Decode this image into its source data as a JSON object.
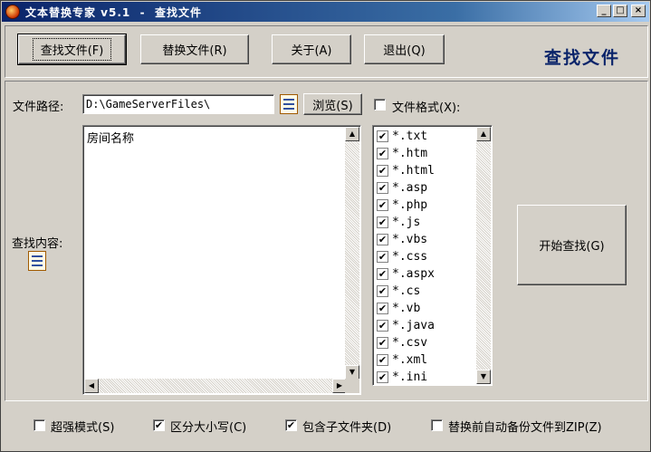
{
  "window": {
    "title": "文本替换专家 v5.1  -  查找文件"
  },
  "toolbar": {
    "find_files": "查找文件(F)",
    "replace_files": "替换文件(R)",
    "about": "关于(A)",
    "exit": "退出(Q)"
  },
  "page_heading": "查找文件",
  "path": {
    "label": "文件路径:",
    "value": "D:\\GameServerFiles\\",
    "browse": "浏览(S)"
  },
  "file_format": {
    "label": "文件格式(X):",
    "checked": false,
    "items": [
      {
        "ext": "*.txt",
        "checked": true
      },
      {
        "ext": "*.htm",
        "checked": true
      },
      {
        "ext": "*.html",
        "checked": true
      },
      {
        "ext": "*.asp",
        "checked": true
      },
      {
        "ext": "*.php",
        "checked": true
      },
      {
        "ext": "*.js",
        "checked": true
      },
      {
        "ext": "*.vbs",
        "checked": true
      },
      {
        "ext": "*.css",
        "checked": true
      },
      {
        "ext": "*.aspx",
        "checked": true
      },
      {
        "ext": "*.cs",
        "checked": true
      },
      {
        "ext": "*.vb",
        "checked": true
      },
      {
        "ext": "*.java",
        "checked": true
      },
      {
        "ext": "*.csv",
        "checked": true
      },
      {
        "ext": "*.xml",
        "checked": true
      },
      {
        "ext": "*.ini",
        "checked": true
      }
    ]
  },
  "search": {
    "label": "查找内容:",
    "content": "房间名称",
    "start_button": "开始查找(G)"
  },
  "options": {
    "super_mode": {
      "label": "超强模式(S)",
      "checked": false
    },
    "case_sensitive": {
      "label": "区分大小写(C)",
      "checked": true
    },
    "include_subfolders": {
      "label": "包含子文件夹(D)",
      "checked": true
    },
    "backup_zip": {
      "label": "替换前自动备份文件到ZIP(Z)",
      "checked": false
    }
  },
  "glyphs": {
    "check": "✔",
    "unchecked": "",
    "minimize": "_",
    "maximize": "□",
    "close": "×",
    "up": "▲",
    "down": "▼",
    "left": "◀",
    "right": "▶"
  }
}
